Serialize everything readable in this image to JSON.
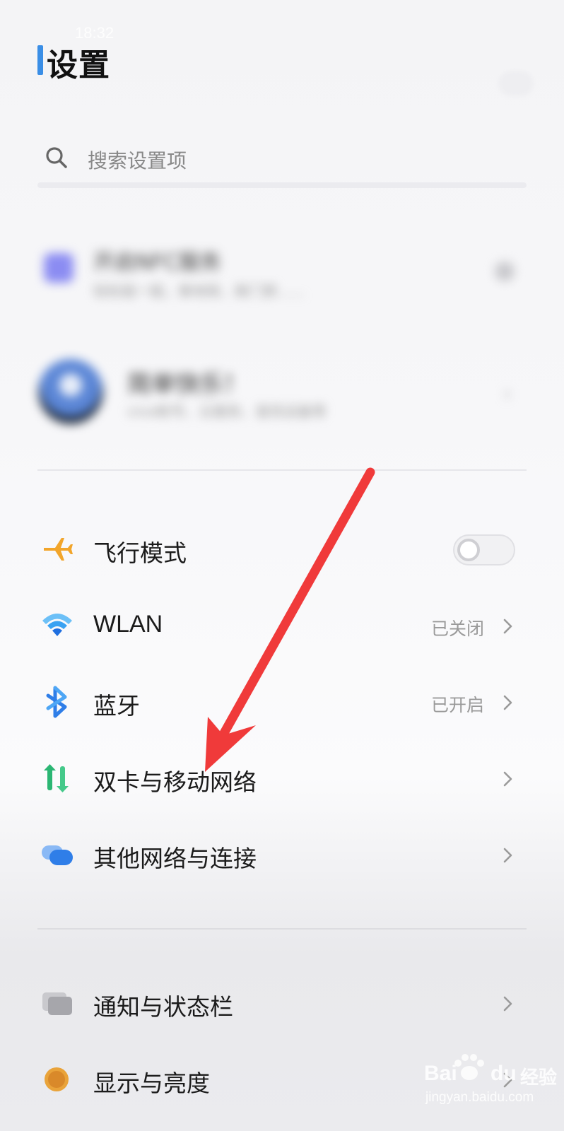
{
  "status": {
    "time": "18:32"
  },
  "header": {
    "title": "设置"
  },
  "search": {
    "placeholder": "搜索设置项"
  },
  "nfc_card": {
    "title": "开启NFC服务",
    "subtitle": "轻松碰一碰，乘地铁、刷门禁……"
  },
  "profile": {
    "name": "简单快乐！",
    "subtitle": "vivo帐号、云服务、查找设备等"
  },
  "settings": {
    "airplane": {
      "label": "飞行模式",
      "enabled": false
    },
    "wlan": {
      "label": "WLAN",
      "value": "已关闭"
    },
    "bluetooth": {
      "label": "蓝牙",
      "value": "已开启"
    },
    "dual_sim": {
      "label": "双卡与移动网络"
    },
    "other_network": {
      "label": "其他网络与连接"
    },
    "notifications": {
      "label": "通知与状态栏"
    },
    "display": {
      "label": "显示与亮度"
    }
  },
  "icons": [
    "airplane-icon",
    "wifi-icon",
    "bluetooth-icon",
    "dual-sim-icon",
    "cloud-icon",
    "notification-icon",
    "display-icon",
    "search-icon",
    "chevron-right-icon"
  ],
  "colors": {
    "accent": "#3a8ee6",
    "airplane": "#f2a52a",
    "wifi": "#2f8ef0",
    "bluetooth": "#2f7ee8",
    "dual_sim": "#2bb673",
    "annotation_arrow": "#f03a3a"
  },
  "watermark": {
    "brand": "Bai",
    "brand2": "du",
    "cn": "经验",
    "url": "jingyan.baidu.com"
  }
}
